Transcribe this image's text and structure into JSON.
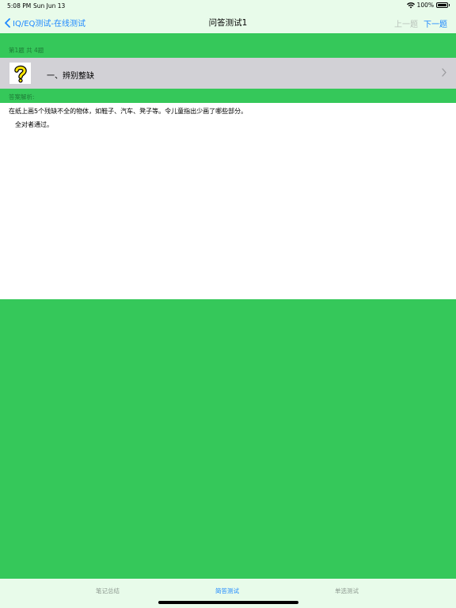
{
  "status_bar": {
    "time": "5:08 PM",
    "date": "Sun Jun 13",
    "battery": "100%"
  },
  "navbar": {
    "back_label": "IQ/EQ测试-在线测试",
    "title": "问答测试1",
    "prev_label": "上一题",
    "next_label": "下一题"
  },
  "question_header": "第1题 共 4题",
  "question": {
    "icon": "question-mark-icon",
    "title": "一、辨别整缺"
  },
  "answer_header": "答案解析:",
  "answer": {
    "line1": "在纸上画5个残缺不全的物体，如鞋子、汽车、凳子等。令儿童指出少画了哪些部分。",
    "line2": "全对者通过。"
  },
  "tabs": [
    {
      "label": "笔记总结",
      "selected": false
    },
    {
      "label": "简答测试",
      "selected": true
    },
    {
      "label": "单选测试",
      "selected": false
    }
  ],
  "colors": {
    "accent": "#1E88FF",
    "background_green": "#35C85A",
    "bar_background": "#E8FBEA",
    "row_gray": "#D2D1D6"
  }
}
